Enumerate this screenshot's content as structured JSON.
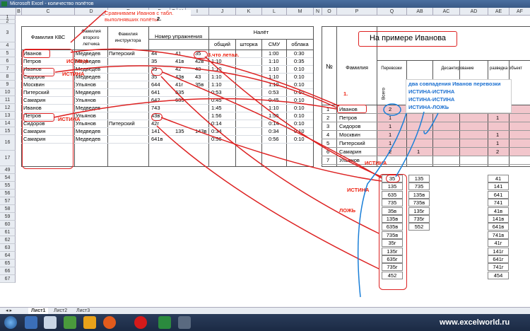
{
  "window": {
    "title": "Microsoft Excel - количество полётов"
  },
  "columns": [
    "B",
    "C",
    "D",
    "E",
    "F",
    "G",
    "H",
    "I",
    "J",
    "K",
    "L",
    "M",
    "N",
    "O",
    "P",
    "Q",
    "AB",
    "AC",
    "AD",
    "AE",
    "AF"
  ],
  "row_numbers": [
    "1",
    "2",
    "3",
    "4",
    "5",
    "6",
    "7",
    "8",
    "9",
    "10",
    "11",
    "12",
    "13",
    "14",
    "15",
    "16",
    "17",
    "49",
    "54",
    "55",
    "56",
    "57",
    "58",
    "59",
    "60",
    "61",
    "62",
    "63",
    "64",
    "65",
    "66",
    "67"
  ],
  "left_headers": {
    "fio_kvs": "Фамилия КВС",
    "fio_second": "Фамилия второго летчика",
    "fio_instructor": "Фамилия инструктора",
    "exercise_no": "Номер упражнения",
    "nalet": "Налёт",
    "total": "общий",
    "shtorka": "шторка",
    "smu": "СМУ",
    "oblaka": "облака"
  },
  "left_rows": [
    {
      "kvs": "Иванов",
      "second": "Медведев",
      "instr": "Питерский",
      "n1": "44",
      "n2": "41",
      "n3": "35",
      "total": "",
      "shtorka": "",
      "smu": "1:00",
      "obl": "0:30"
    },
    {
      "kvs": "Петров",
      "second": "Медведев",
      "instr": "",
      "n1": "35",
      "n2": "41в",
      "n3": "42в",
      "total": "1:10",
      "shtorka": "",
      "smu": "1:10",
      "obl": "0:35"
    },
    {
      "kvs": "Иванов",
      "second": "Медведев",
      "instr": "",
      "n1": "35",
      "n2": "42",
      "n3": "43",
      "total": "1:10",
      "shtorka": "",
      "smu": "1:10",
      "obl": "0:10"
    },
    {
      "kvs": "Сидоров",
      "second": "Медведев",
      "instr": "",
      "n1": "35",
      "n2": "43в",
      "n3": "43",
      "total": "1:10",
      "shtorka": "",
      "smu": "1:10",
      "obl": "0:10"
    },
    {
      "kvs": "Москвин",
      "second": "Ульянов",
      "instr": "",
      "n1": "644",
      "n2": "41г",
      "n3": "35в",
      "total": "1:10",
      "shtorka": "",
      "smu": "1:10",
      "obl": "0:10"
    },
    {
      "kvs": "Питерский",
      "second": "Медведев",
      "instr": "",
      "n1": "641",
      "n2": "635",
      "n3": "",
      "total": "0:53",
      "shtorka": "",
      "smu": "0:53",
      "obl": "0:10"
    },
    {
      "kvs": "Самарин",
      "second": "Ульянов",
      "instr": "",
      "n1": "642",
      "n2": "635",
      "n3": "",
      "total": "0:45",
      "shtorka": "",
      "smu": "0:45",
      "obl": "0:10"
    },
    {
      "kvs": "Иванов",
      "second": "Медведев",
      "instr": "",
      "n1": "743",
      "n2": "",
      "n3": "",
      "total": "1:45",
      "shtorka": "",
      "smu": "1:10",
      "obl": "0:10"
    },
    {
      "kvs": "Петров",
      "second": "Ульянов",
      "instr": "",
      "n1": "43в",
      "n2": "",
      "n3": "",
      "total": "1:56",
      "shtorka": "",
      "smu": "1:56",
      "obl": "0:10"
    },
    {
      "kvs": "Сидоров",
      "second": "Ульянов",
      "instr": "Питерский",
      "n1": "42г",
      "n2": "",
      "n3": "",
      "total": "0:14",
      "shtorka": "",
      "smu": "0:14",
      "obl": "0:10"
    },
    {
      "kvs": "Самарин",
      "second": "Медведев",
      "instr": "",
      "n1": "141",
      "n2": "135",
      "n3": "143в",
      "total": "0:34",
      "shtorka": "",
      "smu": "0:34",
      "obl": "0:10"
    },
    {
      "kvs": "Самарин",
      "second": "Медведев",
      "instr": "",
      "n1": "641в",
      "n2": "",
      "n3": "",
      "total": "0:56",
      "shtorka": "",
      "smu": "0:56",
      "obl": "0:10"
    }
  ],
  "right_header": {
    "title": "На примере Иванова",
    "no": "№",
    "fio": "Фамилия",
    "perevozki": "Перевозки",
    "desant": "Десантирование",
    "razvedka": "разведка объект",
    "vsego": "Всего"
  },
  "right_rows": [
    {
      "n": "1",
      "fio": "Иванов",
      "v1": "2",
      "v2": "",
      "v3": ""
    },
    {
      "n": "2",
      "fio": "Петров",
      "v1": "1",
      "v2": "",
      "v3": "1"
    },
    {
      "n": "3",
      "fio": "Сидоров",
      "v1": "1",
      "v2": "",
      "v3": ""
    },
    {
      "n": "4",
      "fio": "Москвин",
      "v1": "1",
      "v2": "",
      "v3": "1"
    },
    {
      "n": "5",
      "fio": "Питерский",
      "v1": "1",
      "v2": "",
      "v3": "1"
    },
    {
      "n": "6",
      "fio": "Самарин",
      "v1": "2",
      "v2": "1",
      "v3": "2"
    },
    {
      "n": "7",
      "fio": "Ульянов",
      "v1": "",
      "v2": "",
      "v3": ""
    }
  ],
  "list1": [
    "35",
    "135",
    "635",
    "735",
    "35в",
    "135в",
    "635в",
    "735в",
    "35г",
    "135г",
    "635г",
    "735г",
    "452"
  ],
  "list2": [
    "135",
    "735",
    "135в",
    "735в",
    "135г",
    "735г",
    "552"
  ],
  "list3": [
    "41",
    "141",
    "641",
    "741",
    "41в",
    "141в",
    "641в",
    "741в",
    "41г",
    "141г",
    "641г",
    "741г",
    "454"
  ],
  "annotations": {
    "compare": "Сравниваем Иванов с табл. выполнявших полёты",
    "step2": "2.",
    "step1": "1.",
    "step3": "3.что летал.",
    "istina1": "ИСТИНА",
    "istina2": "ИСТИНА",
    "istina3": "ИСТИНА",
    "istina4": "ИСТИНА",
    "istina5": "ИСТИНА",
    "lozh": "ЛОЖЬ",
    "blue1": "два совпадения Иванов перевозки",
    "blue2": "ИСТИНА-ИСТИНА",
    "blue3": "ИСТИНА-ИСТИНА",
    "blue4": "ИСТИНА-ЛОЖЬ"
  },
  "sheet_tabs": [
    "Лист1",
    "Лист2",
    "Лист3"
  ],
  "watermark": "www.excelworld.ru"
}
